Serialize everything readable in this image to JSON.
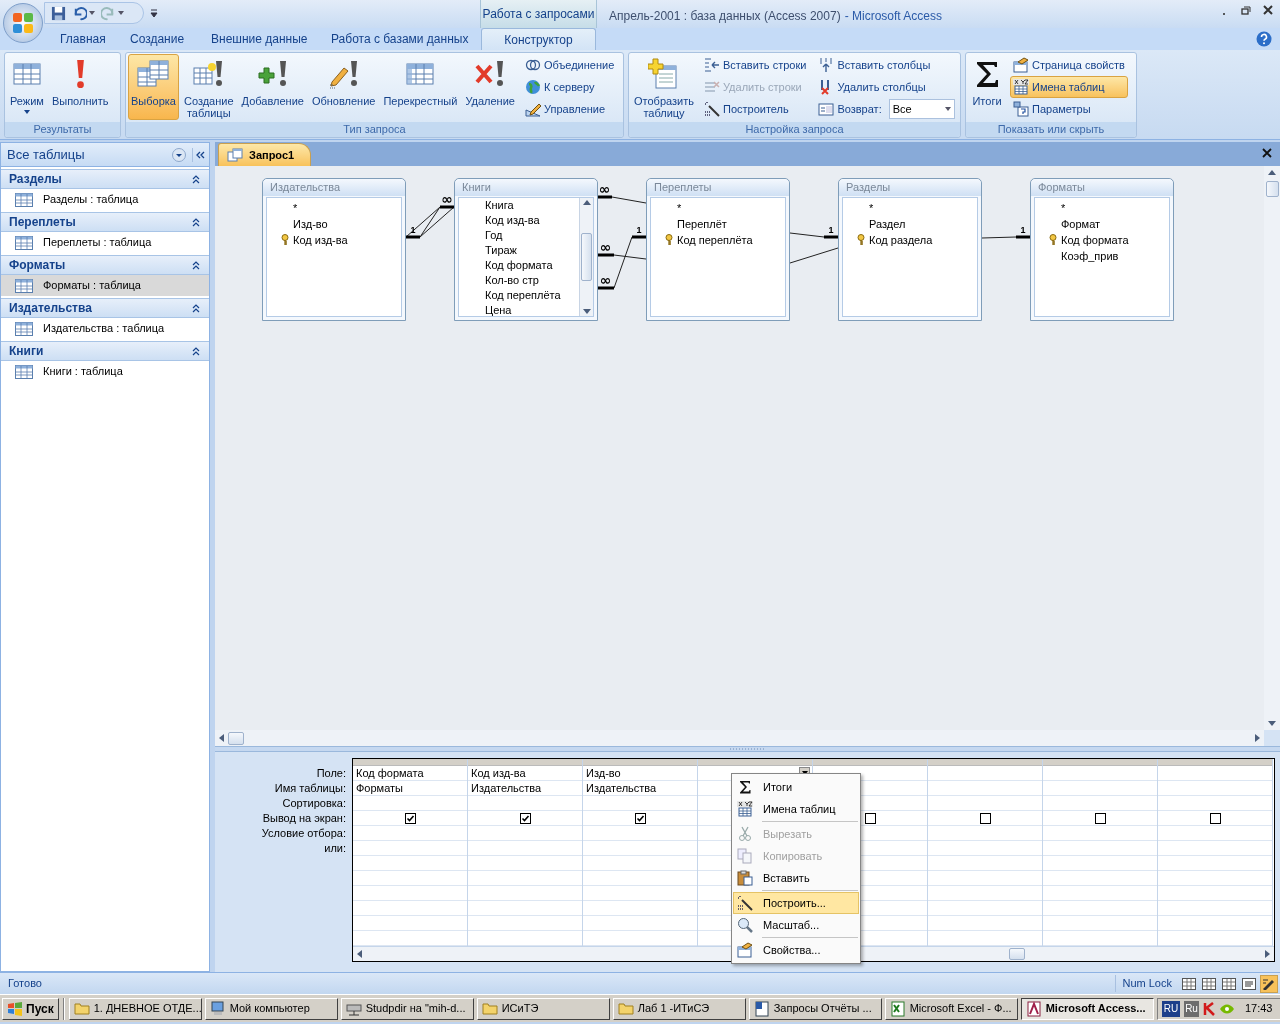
{
  "window": {
    "title": "Апрель-2001 : база данных (Access 2007)",
    "app": "- Microsoft Access",
    "context_group": "Работа с запросами"
  },
  "ribbon_tabs": [
    {
      "label": "Главная",
      "selected": false
    },
    {
      "label": "Создание",
      "selected": false
    },
    {
      "label": "Внешние данные",
      "selected": false
    },
    {
      "label": "Работа с базами данных",
      "selected": false
    },
    {
      "label": "Конструктор",
      "selected": true
    }
  ],
  "ribbon_groups": [
    {
      "title": "Результаты",
      "columns": [
        {
          "kind": "large",
          "label": "Режим",
          "selected": false,
          "dropdown": true
        },
        {
          "kind": "large",
          "label": "Выполнить",
          "selected": false
        }
      ]
    },
    {
      "title": "Тип запроса",
      "columns": [
        {
          "kind": "large",
          "label": "Выборка",
          "selected": true
        },
        {
          "kind": "large",
          "label": "Создание таблицы",
          "selected": false
        },
        {
          "kind": "large",
          "label": "Добавление",
          "selected": false
        },
        {
          "kind": "large",
          "label": "Обновление",
          "selected": false
        },
        {
          "kind": "large",
          "label": "Перекрестный",
          "selected": false
        },
        {
          "kind": "large",
          "label": "Удаление",
          "selected": false
        },
        {
          "kind": "stack",
          "items": [
            {
              "kind": "button",
              "label": "Объединение",
              "disabled": false,
              "selected": false
            },
            {
              "kind": "button",
              "label": "К серверу",
              "disabled": false,
              "selected": false
            },
            {
              "kind": "button",
              "label": "Управление",
              "disabled": false,
              "selected": false
            }
          ]
        }
      ]
    },
    {
      "title": "Настройка запроса",
      "columns": [
        {
          "kind": "large",
          "label": "Отобразить таблицу",
          "selected": false
        },
        {
          "kind": "stack",
          "items": [
            {
              "kind": "button",
              "label": "Вставить строки",
              "disabled": false,
              "selected": false
            },
            {
              "kind": "button",
              "label": "Удалить строки",
              "disabled": true,
              "selected": false
            },
            {
              "kind": "button",
              "label": "Построитель",
              "disabled": false,
              "selected": false
            }
          ]
        },
        {
          "kind": "stack",
          "items": [
            {
              "kind": "button",
              "label": "Вставить столбцы",
              "disabled": false,
              "selected": false
            },
            {
              "kind": "button",
              "label": "Удалить столбцы",
              "disabled": false,
              "selected": false
            },
            {
              "kind": "combo",
              "label": "Возврат:",
              "value": "Все",
              "disabled": false,
              "selected": false
            }
          ]
        }
      ]
    },
    {
      "title": "Показать или скрыть",
      "columns": [
        {
          "kind": "large",
          "label": "Итоги",
          "selected": false
        },
        {
          "kind": "stack",
          "items": [
            {
              "kind": "button",
              "label": "Страница свойств",
              "disabled": false,
              "selected": false
            },
            {
              "kind": "button",
              "label": "Имена таблиц",
              "disabled": false,
              "selected": true
            },
            {
              "kind": "button",
              "label": "Параметры",
              "disabled": false,
              "selected": false
            }
          ]
        }
      ]
    }
  ],
  "navigation": {
    "header": "Все таблицы",
    "groups": [
      {
        "title": "Разделы",
        "expanded": true,
        "items": [
          {
            "label": "Разделы : таблица",
            "selected": false
          }
        ]
      },
      {
        "title": "Переплеты",
        "expanded": true,
        "items": [
          {
            "label": "Переплеты : таблица",
            "selected": false
          }
        ]
      },
      {
        "title": "Форматы",
        "expanded": true,
        "items": [
          {
            "label": "Форматы : таблица",
            "selected": true
          }
        ]
      },
      {
        "title": "Издательства",
        "expanded": true,
        "items": [
          {
            "label": "Издательства : таблица",
            "selected": false
          }
        ]
      },
      {
        "title": "Книги",
        "expanded": true,
        "items": [
          {
            "label": "Книги : таблица",
            "selected": false
          }
        ]
      }
    ]
  },
  "document_tab": {
    "label": "Запрос1"
  },
  "query_tables": [
    {
      "title": "Издательства",
      "fields": [
        {
          "name": "*",
          "key": false
        },
        {
          "name": "Изд-во",
          "key": false
        },
        {
          "name": "Код изд-ва",
          "key": true
        }
      ]
    },
    {
      "title": "Книги",
      "fields": [
        {
          "name": "Книга",
          "key": false
        },
        {
          "name": "Код изд-ва",
          "key": false
        },
        {
          "name": "Год",
          "key": false
        },
        {
          "name": "Тираж",
          "key": false
        },
        {
          "name": "Код формата",
          "key": false
        },
        {
          "name": "Кол-во стр",
          "key": false
        },
        {
          "name": "Код переплёта",
          "key": false
        },
        {
          "name": "Цена",
          "key": false
        }
      ]
    },
    {
      "title": "Переплеты",
      "fields": [
        {
          "name": "*",
          "key": false
        },
        {
          "name": "Переплёт",
          "key": false
        },
        {
          "name": "Код переплёта",
          "key": true
        }
      ]
    },
    {
      "title": "Разделы",
      "fields": [
        {
          "name": "*",
          "key": false
        },
        {
          "name": "Раздел",
          "key": false
        },
        {
          "name": "Код раздела",
          "key": true
        }
      ]
    },
    {
      "title": "Форматы",
      "fields": [
        {
          "name": "*",
          "key": false
        },
        {
          "name": "Формат",
          "key": false
        },
        {
          "name": "Код формата",
          "key": true
        },
        {
          "name": "Коэф_прив",
          "key": false
        }
      ]
    }
  ],
  "joins": {
    "one_ends": [
      "1",
      "1",
      "1",
      "1"
    ],
    "many_ends": [
      "∞",
      "∞",
      "∞",
      "∞"
    ]
  },
  "design_grid": {
    "row_labels": [
      "Поле:",
      "Имя таблицы:",
      "Сортировка:",
      "Вывод на экран:",
      "Условие отбора:",
      "или:"
    ],
    "columns": [
      {
        "field": "Код формата",
        "table": "Форматы",
        "show": true,
        "active": false
      },
      {
        "field": "Код изд-ва",
        "table": "Издательства",
        "show": true,
        "active": false
      },
      {
        "field": "Изд-во",
        "table": "Издательства",
        "show": true,
        "active": false
      },
      {
        "active": true
      },
      {
        "show": false,
        "active": false
      },
      {
        "show": false,
        "active": false
      },
      {
        "show": false,
        "active": false
      },
      {
        "show": false,
        "active": false
      }
    ]
  },
  "context_menu": {
    "groups": [
      {
        "items": [
          {
            "label": "Итоги",
            "disabled": false,
            "highlighted": false
          },
          {
            "label": "Имена таблиц",
            "disabled": false,
            "highlighted": false
          }
        ]
      },
      {
        "items": [
          {
            "label": "Вырезать",
            "disabled": true,
            "highlighted": false
          },
          {
            "label": "Копировать",
            "disabled": true,
            "highlighted": false
          },
          {
            "label": "Вставить",
            "disabled": false,
            "highlighted": false
          }
        ]
      },
      {
        "items": [
          {
            "label": "Построить...",
            "disabled": false,
            "highlighted": true
          },
          {
            "label": "Масштаб...",
            "disabled": false,
            "highlighted": false
          }
        ]
      },
      {
        "items": [
          {
            "label": "Свойства...",
            "disabled": false,
            "highlighted": false
          }
        ]
      }
    ]
  },
  "status_bar": {
    "text": "Готово",
    "indicator": "Num Lock"
  },
  "taskbar": {
    "start": "Пуск",
    "tasks": [
      {
        "label": "1. ДНЕВНОЕ ОТДЕ...",
        "selected": false
      },
      {
        "label": "Мой компьютер",
        "selected": false
      },
      {
        "label": "Studpdir на \"mih-d...",
        "selected": false
      },
      {
        "label": "ИСиТЭ",
        "selected": false
      },
      {
        "label": "Лаб 1 -ИТиСЭ",
        "selected": false
      },
      {
        "label": "Запросы Отчёты ...",
        "selected": false
      },
      {
        "label": "Microsoft Excel - Ф...",
        "selected": false
      },
      {
        "label": "Microsoft Access...",
        "selected": true
      }
    ],
    "tray": {
      "language": "RU",
      "keyboard": "Ru",
      "clock": "17:43"
    }
  }
}
